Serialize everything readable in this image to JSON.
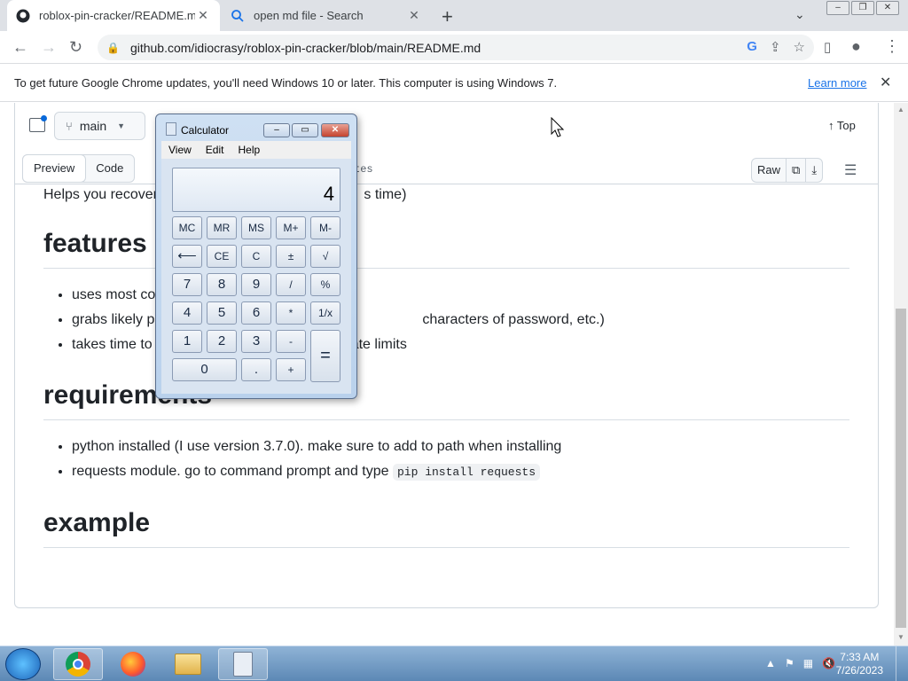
{
  "browser": {
    "tabs": [
      {
        "title": "roblox-pin-cracker/README.md",
        "close": "✕"
      },
      {
        "title": "open md file - Search",
        "close": "✕"
      }
    ],
    "new_tab": "+",
    "url": "github.com/idiocrasy/roblox-pin-cracker/blob/main/README.md",
    "infobar": {
      "message": "To get future Google Chrome updates, you'll need Windows 10 or later. This computer is using Windows 7.",
      "link": "Learn more",
      "close": "✕"
    }
  },
  "github": {
    "branch": "main",
    "top": "Top",
    "view_tabs": [
      "Preview",
      "Code"
    ],
    "bytes": "tes",
    "raw": "Raw",
    "readme": {
      "intro": "Helps you recover",
      "intro_tail": "s time)",
      "features_title": "features",
      "features": [
        "uses most co",
        "grabs likely p",
        "takes time to"
      ],
      "features_tails": [
        "",
        "characters of password, etc.)",
        "ate limits"
      ],
      "requirements_title": "requirements",
      "requirements": [
        "python installed (I use version 3.7.0). make sure to add to path when installing",
        "requests module. go to command prompt and type "
      ],
      "pip_cmd": "pip install requests",
      "example_title": "example"
    }
  },
  "calculator": {
    "title": "Calculator",
    "menu": [
      "View",
      "Edit",
      "Help"
    ],
    "display": "4",
    "keys": {
      "mc": "MC",
      "mr": "MR",
      "ms": "MS",
      "mplus": "M+",
      "mminus": "M-",
      "back": "⟵",
      "ce": "CE",
      "c": "C",
      "pm": "±",
      "sqrt": "√",
      "k7": "7",
      "k8": "8",
      "k9": "9",
      "div": "/",
      "pct": "%",
      "k4": "4",
      "k5": "5",
      "k6": "6",
      "mul": "*",
      "inv": "1/x",
      "k1": "1",
      "k2": "2",
      "k3": "3",
      "sub": "-",
      "eq": "=",
      "k0": "0",
      "dot": ".",
      "add": "+"
    }
  },
  "taskbar": {
    "time": "7:33 AM",
    "date": "7/26/2023"
  }
}
